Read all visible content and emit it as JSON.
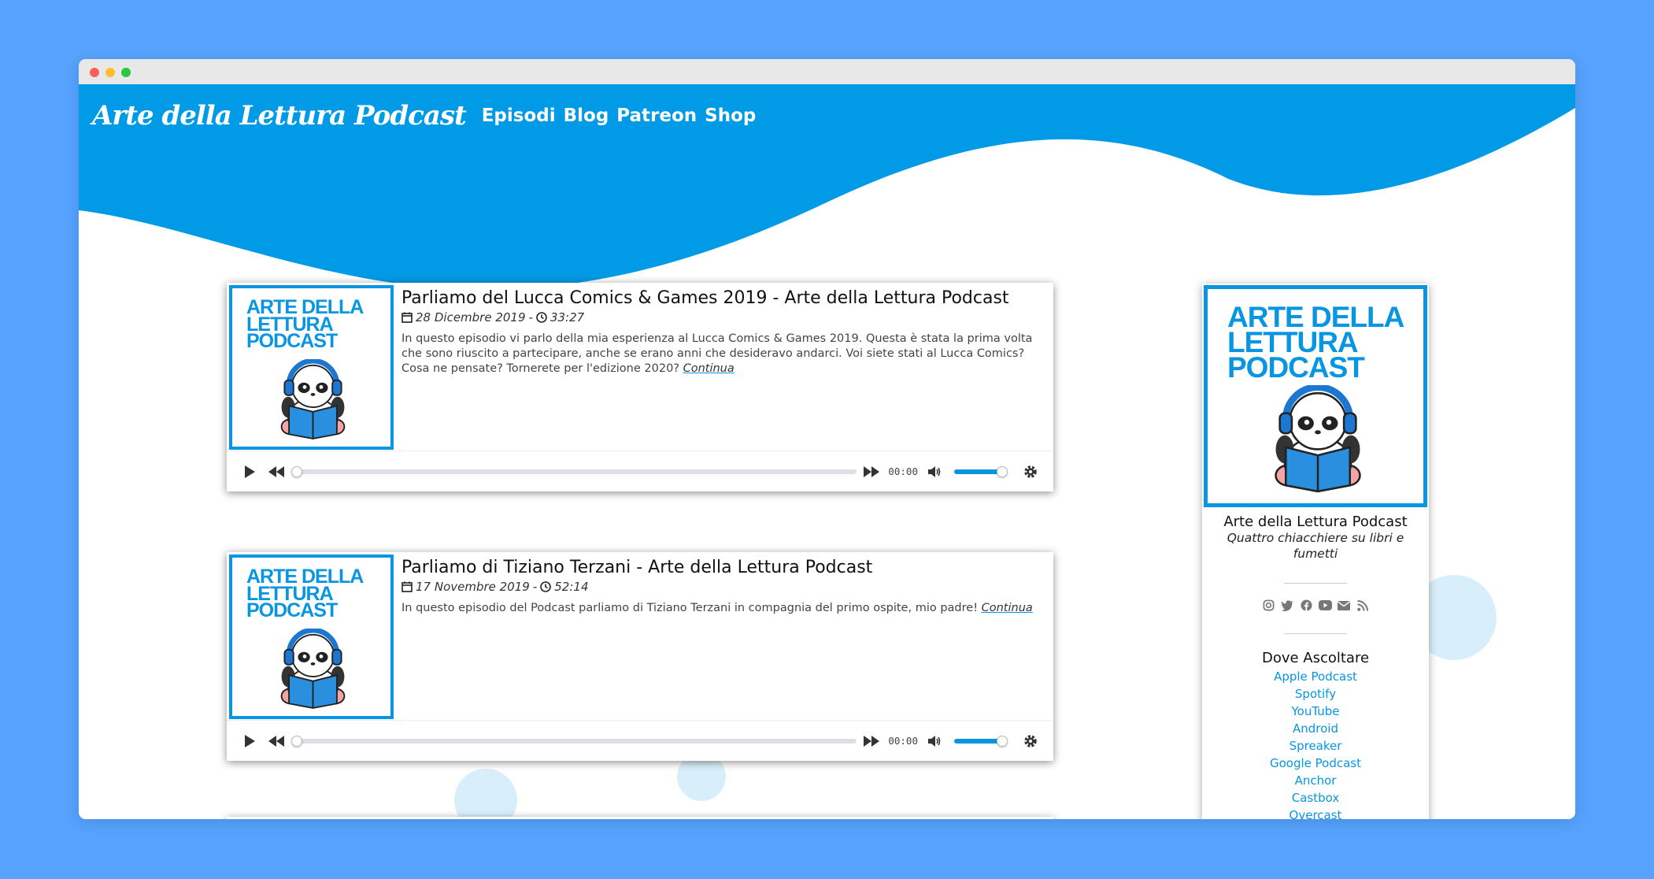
{
  "browser": {
    "dots": [
      "#ff5f57",
      "#febc2e",
      "#28c840"
    ]
  },
  "site": {
    "title": "Arte della Lettura Podcast",
    "nav": [
      "Episodi",
      "Blog",
      "Patreon",
      "Shop"
    ]
  },
  "colors": {
    "accent": "#0895e1",
    "header": "#009ae6",
    "background": "#56a2fd"
  },
  "cover_logo": {
    "line1": "ARTE DELLA",
    "line2": "LETTURA",
    "line3": "PODCAST"
  },
  "episodes": [
    {
      "title": "Parliamo del Lucca Comics & Games 2019 - Arte della Lettura Podcast",
      "date": "28 Dicembre 2019",
      "separator": "-",
      "duration": "33:27",
      "description": "In questo episodio vi parlo della mia esperienza al Lucca Comics & Games 2019. Questa è stata la prima volta che sono riuscito a partecipare, anche se erano anni che desideravo andarci. Voi siete stati al Lucca Comics? Cosa ne pensate? Tornerete per l'edizione 2020?",
      "more": "Continua",
      "player": {
        "time": "00:00",
        "progress": 0,
        "volume": 0.85
      }
    },
    {
      "title": "Parliamo di Tiziano Terzani - Arte della Lettura Podcast",
      "date": "17 Novembre 2019",
      "separator": "-",
      "duration": "52:14",
      "description": "In questo episodio del Podcast parliamo di Tiziano Terzani in compagnia del primo ospite, mio padre!",
      "more": "Continua",
      "player": {
        "time": "00:00",
        "progress": 0,
        "volume": 0.85
      }
    }
  ],
  "sidebar": {
    "name": "Arte della Lettura Podcast",
    "tagline": "Quattro chiacchiere su libri e fumetti",
    "socials": [
      "instagram-icon",
      "twitter-icon",
      "facebook-icon",
      "youtube-icon",
      "email-icon",
      "rss-icon"
    ],
    "listen_title": "Dove Ascoltare",
    "listen_links": [
      "Apple Podcast",
      "Spotify",
      "YouTube",
      "Android",
      "Spreaker",
      "Google Podcast",
      "Anchor",
      "Castbox",
      "Overcast"
    ]
  }
}
